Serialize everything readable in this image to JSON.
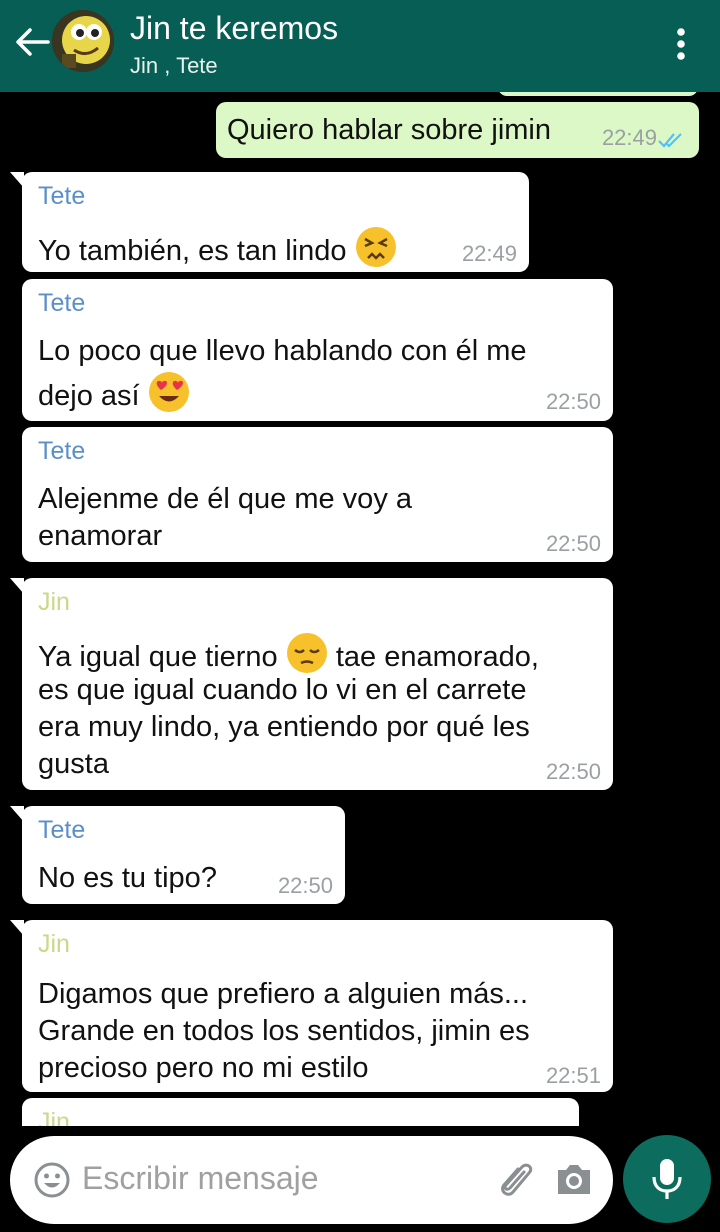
{
  "header": {
    "title": "Jin te keremos",
    "subtitle": "Jin , Tete",
    "icons": [
      "back-arrow-icon",
      "group-avatar",
      "more-vertical-icon"
    ]
  },
  "messages": [
    {
      "direction": "out",
      "text": "Quiero hablar sobre jimin",
      "time": "22:49",
      "status": "read-double-check-icon"
    },
    {
      "direction": "in",
      "sender": "Tete",
      "text_before_emoji": "Yo también, es tan lindo",
      "emoji": "persevering-face-emoji",
      "time": "22:49"
    },
    {
      "direction": "in",
      "sender": "Tete",
      "line1": "Lo poco que llevo hablando con él me",
      "line2": "dejo así",
      "emoji": "heart-eyes-emoji",
      "time": "22:50"
    },
    {
      "direction": "in",
      "sender": "Tete",
      "line1": "Alejenme de él que me voy a",
      "line2": "enamorar",
      "time": "22:50"
    },
    {
      "direction": "in",
      "sender": "Jin",
      "line1a": "Ya igual que tierno",
      "line1b": "tae enamorado,",
      "line2": "es que igual cuando lo vi en el carrete",
      "line3": "era muy lindo, ya entiendo por qué les",
      "line4": "gusta",
      "emoji": "pensive-face-emoji",
      "time": "22:50"
    },
    {
      "direction": "in",
      "sender": "Tete",
      "text": "No es tu tipo?",
      "time": "22:50"
    },
    {
      "direction": "in",
      "sender": "Jin",
      "line1": "Digamos que prefiero a alguien más...",
      "line2": "Grande en todos los sentidos, jimin es",
      "line3": "precioso pero no mi estilo",
      "time": "22:51"
    },
    {
      "direction": "in",
      "sender": "Jin",
      "partial": true
    }
  ],
  "composer": {
    "placeholder": "Escribir mensaje",
    "icons": [
      "emoji-icon",
      "paperclip-icon",
      "camera-icon",
      "microphone-icon"
    ]
  },
  "colors": {
    "header_bg": "#075e54",
    "outgoing_bubble": "#dcf8c6",
    "incoming_bubble": "#ffffff",
    "chat_bg": "#000000",
    "sender_tete": "#5b8fc9",
    "sender_jin": "#c9d98a",
    "read_ticks": "#4fc3f7",
    "mic_button": "#0c6d5f"
  }
}
